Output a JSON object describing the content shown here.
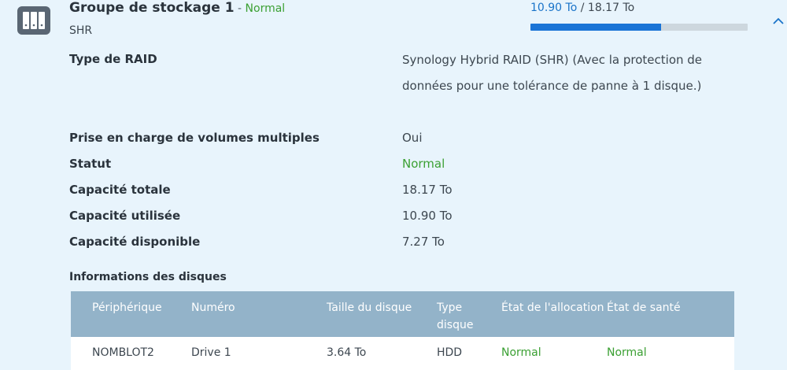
{
  "pool": {
    "title": "Groupe de stockage 1",
    "separator": " - ",
    "status": "Normal",
    "raid_short": "SHR",
    "used": "10.90 To",
    "total_sep": " / ",
    "total": "18.17 To",
    "usage_fraction": 0.6,
    "icon": "storage-pool-icon",
    "toggle_icon": "chevron-up-icon"
  },
  "details": {
    "raid_type_label": "Type de RAID",
    "raid_type_value": "Synology Hybrid RAID (SHR) (Avec la protection de données pour une tolérance de panne à 1 disque.)",
    "multi_volume_label": "Prise en charge de volumes multiples",
    "multi_volume_value": "Oui",
    "status_label": "Statut",
    "status_value": "Normal",
    "total_capacity_label": "Capacité totale",
    "total_capacity_value": "18.17 To",
    "used_capacity_label": "Capacité utilisée",
    "used_capacity_value": "10.90 To",
    "free_capacity_label": "Capacité disponible",
    "free_capacity_value": "7.27 To"
  },
  "disks": {
    "heading": "Informations des disques",
    "columns": [
      "Périphérique",
      "Numéro",
      "Taille du disque",
      "Type disque",
      "État de l'allocation",
      "État de santé"
    ],
    "rows": [
      [
        "NOMBLOT2",
        "Drive 1",
        "3.64 To",
        "HDD",
        "Normal",
        "Normal"
      ]
    ]
  },
  "colors": {
    "background": "#e8f4fc",
    "status_green": "#3ba033",
    "used_blue": "#1a74c9",
    "table_header": "#93b3c9"
  }
}
